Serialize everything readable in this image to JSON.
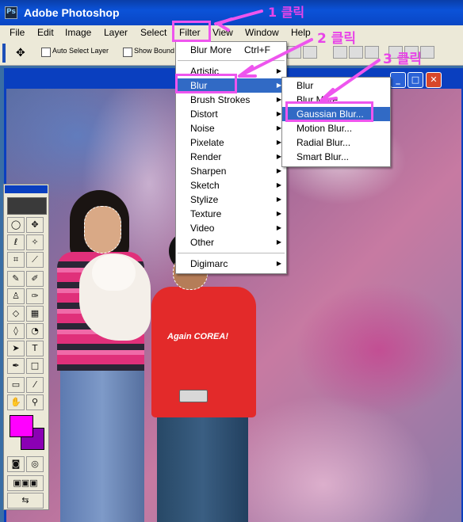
{
  "window": {
    "title": "Adobe Photoshop"
  },
  "menubar": [
    "File",
    "Edit",
    "Image",
    "Layer",
    "Select",
    "Filter",
    "View",
    "Window",
    "Help"
  ],
  "options": {
    "auto_select": "Auto Select Layer",
    "show_bounds": "Show Bound"
  },
  "filter_menu": {
    "items": [
      {
        "label": "Blur More",
        "shortcut": "Ctrl+F"
      },
      {
        "label": "Artistic"
      },
      {
        "label": "Blur"
      },
      {
        "label": "Brush Strokes"
      },
      {
        "label": "Distort"
      },
      {
        "label": "Noise"
      },
      {
        "label": "Pixelate"
      },
      {
        "label": "Render"
      },
      {
        "label": "Sharpen"
      },
      {
        "label": "Sketch"
      },
      {
        "label": "Stylize"
      },
      {
        "label": "Texture"
      },
      {
        "label": "Video"
      },
      {
        "label": "Other"
      },
      {
        "label": "Digimarc"
      }
    ]
  },
  "blur_submenu": {
    "items": [
      "Blur",
      "Blur More",
      "Gaussian Blur...",
      "Motion Blur...",
      "Radial Blur...",
      "Smart Blur..."
    ]
  },
  "annotations": {
    "step1": "1 클릭",
    "step2": "2 클릭",
    "step3": "3 클릭"
  },
  "photo": {
    "shirt_text": "Again COREA!"
  },
  "colors": {
    "foreground": "#ff00ff",
    "background": "#8b00b4",
    "highlight": "#316ac5",
    "annotation": "#e844e8"
  }
}
